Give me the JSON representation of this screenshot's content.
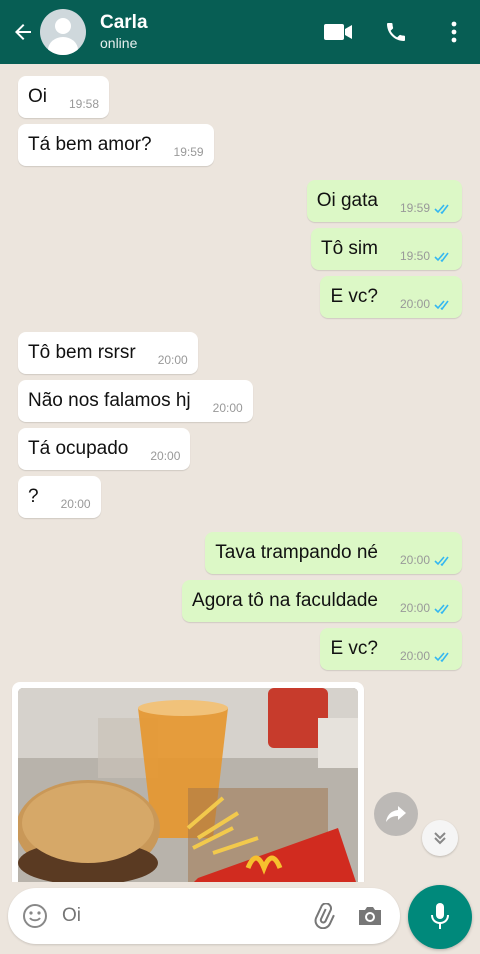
{
  "header": {
    "contact_name": "Carla",
    "contact_status": "online"
  },
  "icons": {
    "back": "arrow-left-icon",
    "video": "video-call-icon",
    "voice": "phone-icon",
    "menu": "more-vert-icon",
    "emoji": "emoji-icon",
    "attach": "paperclip-icon",
    "camera": "camera-icon",
    "mic": "microphone-icon",
    "forward": "forward-icon",
    "scroll": "double-chevron-down-icon"
  },
  "colors": {
    "header": "#075e54",
    "incoming": "#ffffff",
    "outgoing": "#dcf8c6",
    "read_ticks": "#34b7f1",
    "mic_button": "#00897b",
    "chat_bg": "#ece5dd"
  },
  "messages": [
    {
      "dir": "in",
      "text": "Oi",
      "time": "19:58"
    },
    {
      "dir": "in",
      "text": "Tá bem amor?",
      "time": "19:59"
    },
    {
      "dir": "out",
      "text": "Oi gata",
      "time": "19:59",
      "read": true
    },
    {
      "dir": "out",
      "text": "Tô sim",
      "time": "19:50",
      "read": true
    },
    {
      "dir": "out",
      "text": "E vc?",
      "time": "20:00",
      "read": true
    },
    {
      "dir": "in",
      "text": "Tô bem rsrsr",
      "time": "20:00"
    },
    {
      "dir": "in",
      "text": "Não nos falamos hj",
      "time": "20:00"
    },
    {
      "dir": "in",
      "text": "Tá ocupado",
      "time": "20:00"
    },
    {
      "dir": "in",
      "text": "?",
      "time": "20:00"
    },
    {
      "dir": "out",
      "text": "Tava trampando né",
      "time": "20:00",
      "read": true
    },
    {
      "dir": "out",
      "text": "Agora tô na faculdade",
      "time": "20:00",
      "read": true
    },
    {
      "dir": "out",
      "text": "E vc?",
      "time": "20:00",
      "read": true
    }
  ],
  "photo_message": {
    "dir": "in",
    "content": "photo-fast-food-meal"
  },
  "composer": {
    "value": "",
    "placeholder": "Oi"
  }
}
